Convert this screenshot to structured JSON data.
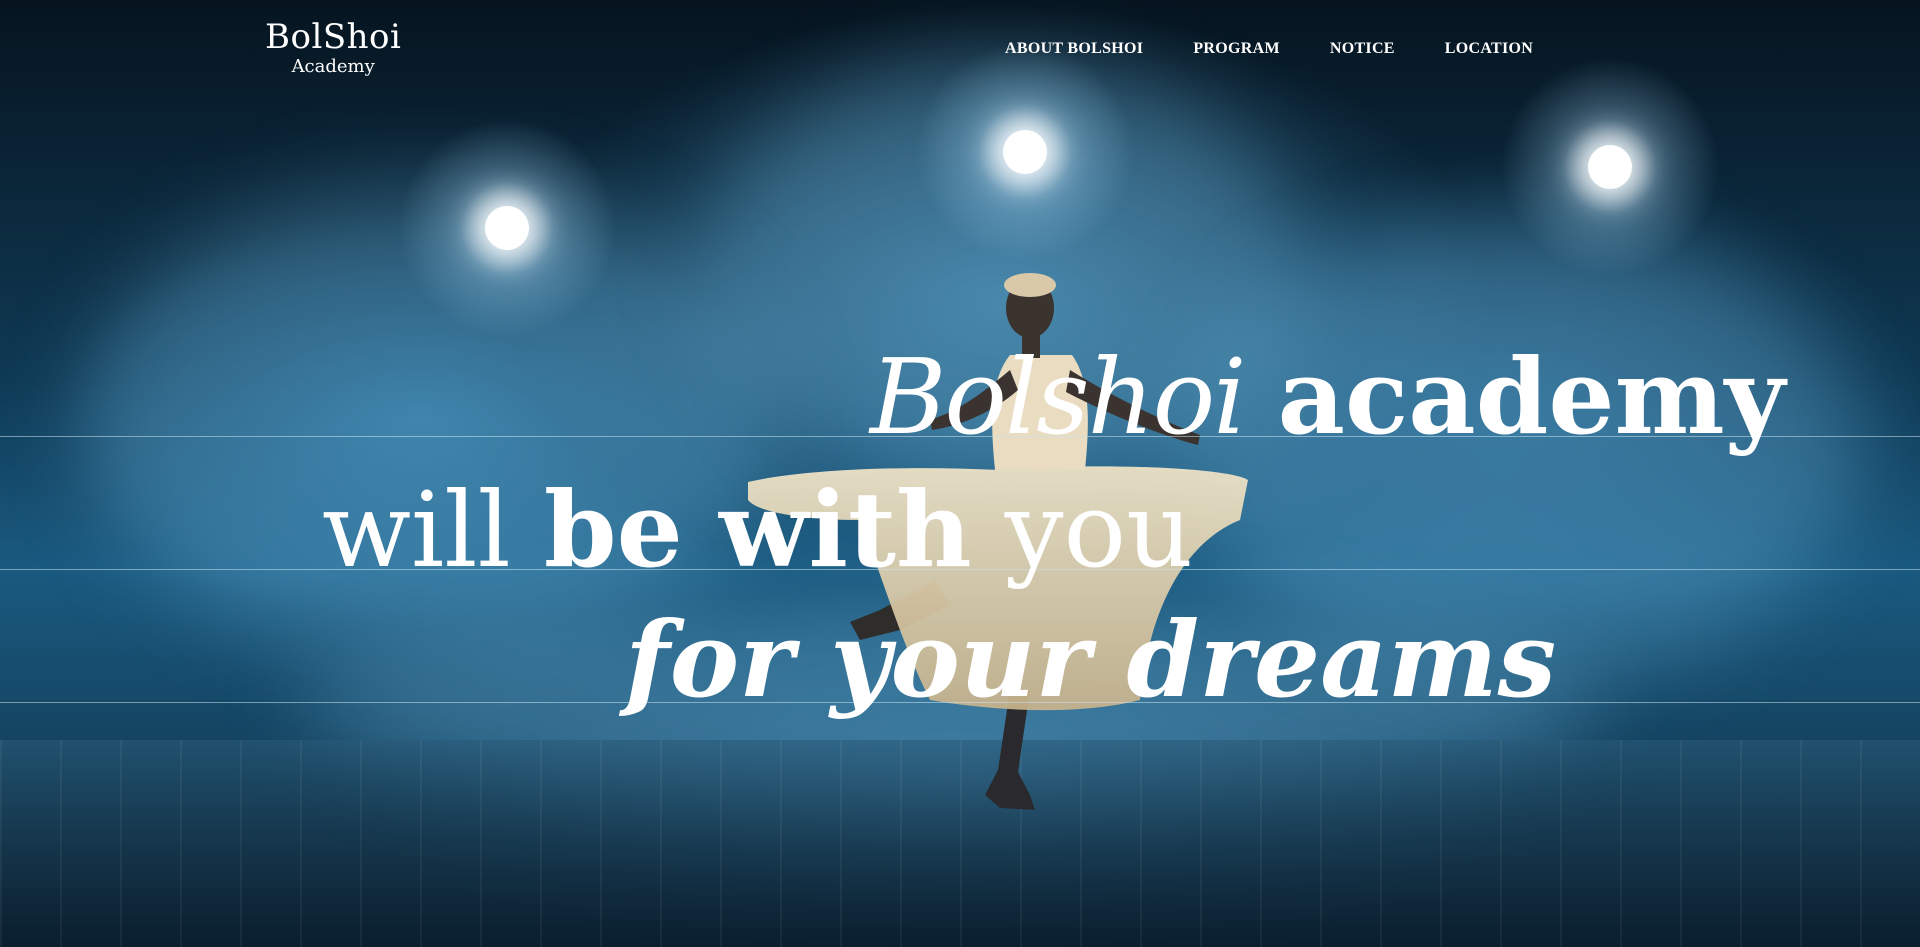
{
  "brand": {
    "name": "BolShoi",
    "sub": "Academy"
  },
  "nav": {
    "items": [
      {
        "label": "ABOUT BOLSHOI"
      },
      {
        "label": "PROGRAM"
      },
      {
        "label": "NOTICE"
      },
      {
        "label": "LOCATION"
      }
    ]
  },
  "hero": {
    "line1": {
      "part1": "Bolshoi",
      "part2": "academy"
    },
    "line2": {
      "part1": "will",
      "part2": "be with",
      "part3": "you"
    },
    "line3": "for your dreams",
    "colors": {
      "text": "#ffffff",
      "fog": "#4a9ccb",
      "background": "#06141f"
    }
  }
}
